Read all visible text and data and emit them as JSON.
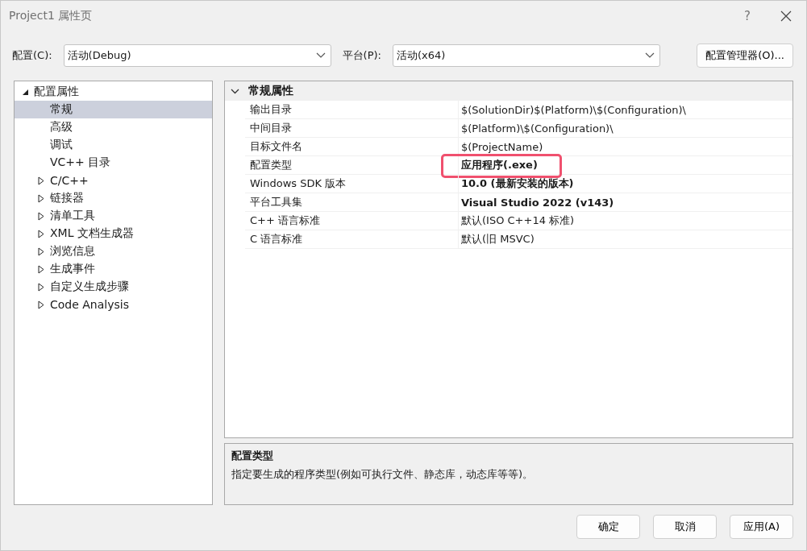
{
  "window": {
    "title": "Project1 属性页",
    "help": "?"
  },
  "config": {
    "label": "配置(C):",
    "value": "活动(Debug)"
  },
  "platform": {
    "label": "平台(P):",
    "value": "活动(x64)"
  },
  "config_manager_button": "配置管理器(O)...",
  "tree": [
    {
      "label": "配置属性",
      "expanded": true,
      "selected": false,
      "children": [
        {
          "label": "常规",
          "selected": true
        },
        {
          "label": "高级",
          "selected": false
        },
        {
          "label": "调试",
          "selected": false
        },
        {
          "label": "VC++ 目录",
          "selected": false
        },
        {
          "label": "C/C++",
          "expanded": false,
          "selected": false
        },
        {
          "label": "链接器",
          "expanded": false,
          "selected": false
        },
        {
          "label": "清单工具",
          "expanded": false,
          "selected": false
        },
        {
          "label": "XML 文档生成器",
          "expanded": false,
          "selected": false
        },
        {
          "label": "浏览信息",
          "expanded": false,
          "selected": false
        },
        {
          "label": "生成事件",
          "expanded": false,
          "selected": false
        },
        {
          "label": "自定义生成步骤",
          "expanded": false,
          "selected": false
        },
        {
          "label": "Code Analysis",
          "expanded": false,
          "selected": false
        }
      ]
    }
  ],
  "property_group": {
    "title": "常规属性",
    "expanded": true,
    "rows": [
      {
        "name": "输出目录",
        "value": "$(SolutionDir)$(Platform)\\$(Configuration)\\",
        "bold": false,
        "highlighted": false
      },
      {
        "name": "中间目录",
        "value": "$(Platform)\\$(Configuration)\\",
        "bold": false,
        "highlighted": false
      },
      {
        "name": "目标文件名",
        "value": "$(ProjectName)",
        "bold": false,
        "highlighted": false
      },
      {
        "name": "配置类型",
        "value": "应用程序(.exe)",
        "bold": true,
        "highlighted": true
      },
      {
        "name": "Windows SDK 版本",
        "value": "10.0 (最新安装的版本)",
        "bold": true,
        "highlighted": false
      },
      {
        "name": "平台工具集",
        "value": "Visual Studio 2022 (v143)",
        "bold": true,
        "highlighted": false
      },
      {
        "name": "C++ 语言标准",
        "value": "默认(ISO C++14 标准)",
        "bold": false,
        "highlighted": false
      },
      {
        "name": "C 语言标准",
        "value": "默认(旧 MSVC)",
        "bold": false,
        "highlighted": false
      }
    ]
  },
  "description": {
    "title": "配置类型",
    "text": "指定要生成的程序类型(例如可执行文件、静态库，动态库等等)。"
  },
  "buttons": [
    "确定",
    "取消",
    "应用(A)"
  ]
}
